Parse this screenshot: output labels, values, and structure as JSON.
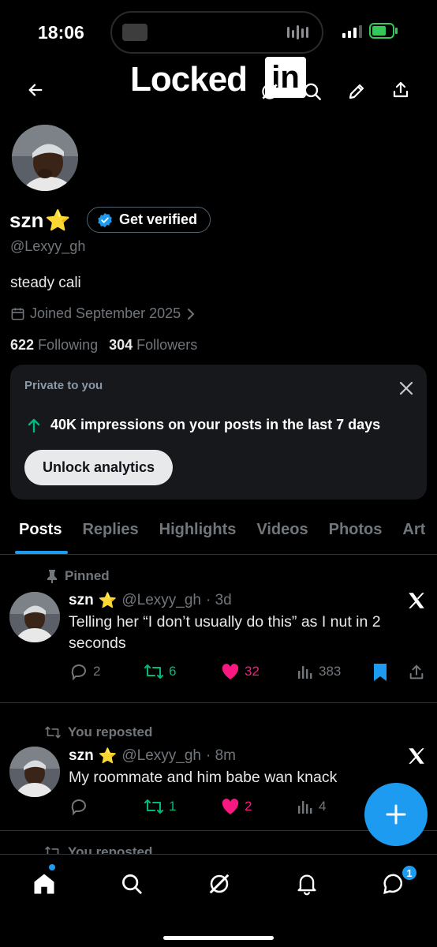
{
  "status_bar": {
    "time": "18:06"
  },
  "header": {
    "watermark_text": "Locked",
    "watermark_box": "in"
  },
  "profile": {
    "name": "szn",
    "name_emoji": "⭐",
    "verify_label": "Get verified",
    "handle": "@Lexyy_gh",
    "bio": "steady cali",
    "joined": "Joined September 2025",
    "following_count": "622",
    "following_label": "Following",
    "followers_count": "304",
    "followers_label": "Followers"
  },
  "analytics_card": {
    "title": "Private to you",
    "impressions_text": "40K impressions on your posts in the last 7 days",
    "button_label": "Unlock analytics"
  },
  "tabs": [
    {
      "label": "Posts"
    },
    {
      "label": "Replies"
    },
    {
      "label": "Highlights"
    },
    {
      "label": "Videos"
    },
    {
      "label": "Photos"
    },
    {
      "label": "Art"
    }
  ],
  "posts": [
    {
      "context": "Pinned",
      "name": "szn",
      "emoji": "⭐",
      "handle": "@Lexyy_gh",
      "time": "· 3d",
      "text": "Telling her “I don’t usually do this” as I nut in 2 seconds",
      "replies": "2",
      "reposts": "6",
      "likes": "32",
      "views": "383"
    },
    {
      "context": "You reposted",
      "name": "szn",
      "emoji": "⭐",
      "handle": "@Lexyy_gh",
      "time": "· 8m",
      "text": "My roommate and him babe wan knack",
      "replies": "",
      "reposts": "1",
      "likes": "2",
      "views": "4"
    }
  ],
  "next_post_context": "You reposted",
  "nav": {
    "messages_badge": "1"
  },
  "colors": {
    "accent": "#1d9bf0",
    "like": "#f91880",
    "repost": "#00ba7c",
    "card_bg": "#16181c"
  }
}
